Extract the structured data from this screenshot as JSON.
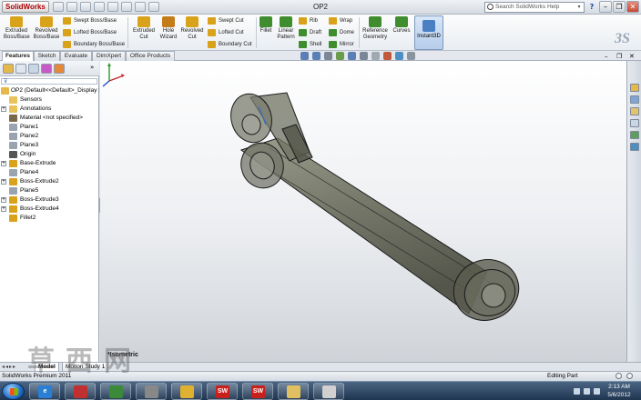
{
  "app": {
    "brand": "SolidWorks",
    "document_title": "OP2",
    "search_placeholder": "Search SolidWorks Help"
  },
  "ribbon": {
    "large_buttons": [
      {
        "id": "extruded-boss",
        "label": "Extruded Boss/Base",
        "color": "#d9a21b"
      },
      {
        "id": "revolved-boss",
        "label": "Revolved Boss/Base",
        "color": "#d9a21b"
      },
      {
        "id": "extruded-cut",
        "label": "Extruded Cut",
        "color": "#d9a21b"
      },
      {
        "id": "hole-wizard",
        "label": "Hole Wizard",
        "color": "#c47c1a"
      },
      {
        "id": "revolved-cut",
        "label": "Revolved Cut",
        "color": "#d9a21b"
      },
      {
        "id": "fillet",
        "label": "Fillet",
        "color": "#3f8d2e"
      },
      {
        "id": "linear-pattern",
        "label": "Linear Pattern",
        "color": "#3f8d2e"
      },
      {
        "id": "reference-geometry",
        "label": "Reference Geometry",
        "color": "#3f8d2e"
      },
      {
        "id": "curves",
        "label": "Curves",
        "color": "#3f8d2e"
      }
    ],
    "small_buttons": [
      {
        "id": "swept-boss",
        "label": "Swept Boss/Base"
      },
      {
        "id": "lofted-boss",
        "label": "Lofted Boss/Base"
      },
      {
        "id": "boundary-boss",
        "label": "Boundary Boss/Base"
      },
      {
        "id": "swept-cut",
        "label": "Swept Cut"
      },
      {
        "id": "lofted-cut",
        "label": "Lofted Cut"
      },
      {
        "id": "boundary-cut",
        "label": "Boundary Cut"
      },
      {
        "id": "rib",
        "label": "Rib"
      },
      {
        "id": "draft",
        "label": "Draft"
      },
      {
        "id": "shell",
        "label": "Shell"
      },
      {
        "id": "wrap",
        "label": "Wrap"
      },
      {
        "id": "dome",
        "label": "Dome"
      },
      {
        "id": "mirror",
        "label": "Mirror"
      }
    ],
    "instant3d_label": "Instant3D"
  },
  "command_tabs": [
    "Features",
    "Sketch",
    "Evaluate",
    "DimXpert",
    "Office Products"
  ],
  "feature_tree": {
    "root": "OP2  (Default<<Default>_Display State 1>)",
    "items": [
      {
        "label": "Sensors",
        "expandable": false,
        "icon_color": "#e8c35a"
      },
      {
        "label": "Annotations",
        "expandable": true,
        "icon_color": "#e8c35a"
      },
      {
        "label": "Material <not specified>",
        "expandable": false,
        "icon_color": "#7a6a4a"
      },
      {
        "label": "Plane1",
        "expandable": false,
        "icon_color": "#9aa4b0"
      },
      {
        "label": "Plane2",
        "expandable": false,
        "icon_color": "#9aa4b0"
      },
      {
        "label": "Plane3",
        "expandable": false,
        "icon_color": "#9aa4b0"
      },
      {
        "label": "Origin",
        "expandable": false,
        "icon_color": "#555555"
      },
      {
        "label": "Base-Extrude",
        "expandable": true,
        "icon_color": "#d9a21b"
      },
      {
        "label": "Plane4",
        "expandable": false,
        "icon_color": "#9aa4b0"
      },
      {
        "label": "Boss-Extrude2",
        "expandable": true,
        "icon_color": "#d9a21b"
      },
      {
        "label": "Plane5",
        "expandable": false,
        "icon_color": "#9aa4b0"
      },
      {
        "label": "Boss-Extrude3",
        "expandable": true,
        "icon_color": "#d9a21b"
      },
      {
        "label": "Boss-Extrude4",
        "expandable": true,
        "icon_color": "#d9a21b"
      },
      {
        "label": "Fillet2",
        "expandable": false,
        "icon_color": "#d9a21b"
      }
    ]
  },
  "viewport": {
    "view_orientation": "*Isometric"
  },
  "bottom_tabs": [
    "Model",
    "Motion Study 1"
  ],
  "status": {
    "left": "SolidWorks Premium 2011",
    "right": "Editing Part"
  },
  "watermark": "草西网",
  "taskbar": {
    "apps": [
      {
        "id": "ie",
        "glyph": "e",
        "color": "#2a7fd4"
      },
      {
        "id": "app2",
        "glyph": "",
        "color": "#c03030"
      },
      {
        "id": "app3",
        "glyph": "",
        "color": "#3a8a3a"
      },
      {
        "id": "app4",
        "glyph": "",
        "color": "#888888"
      },
      {
        "id": "app5",
        "glyph": "",
        "color": "#e0b030"
      },
      {
        "id": "solidworks1",
        "glyph": "SW",
        "color": "#c8201c"
      },
      {
        "id": "solidworks2",
        "glyph": "SW",
        "color": "#c8201c"
      },
      {
        "id": "explorer",
        "glyph": "",
        "color": "#e0c060"
      },
      {
        "id": "app9",
        "glyph": "",
        "color": "#d0d0d0"
      }
    ],
    "time": "2:13 AM",
    "date": "5/6/2012"
  },
  "colors": {
    "part_fill": "#6b6d5c",
    "part_edge": "#1a1a1a",
    "accent": "#3b6fb6"
  }
}
